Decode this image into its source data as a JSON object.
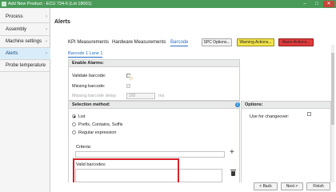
{
  "window": {
    "title": "Add New Product - ECU 734-6 (Lot 18001)",
    "minimize": "–",
    "maximize": "□",
    "close": "✕"
  },
  "sidebar": {
    "items": [
      {
        "label": "Process",
        "chevron": "›"
      },
      {
        "label": "Assembly",
        "chevron": "›"
      },
      {
        "label": "Machine settings",
        "chevron": "›"
      },
      {
        "label": "Alerts",
        "chevron": "›"
      },
      {
        "label": "Probe temperature",
        "chevron": ""
      }
    ]
  },
  "main": {
    "heading": "Alerts",
    "tabs": [
      {
        "label": "KPI Measurements"
      },
      {
        "label": "Hardware Measurements"
      },
      {
        "label": "Barcode"
      }
    ],
    "spc_button": "SPC Options...",
    "warning_button": "Warning Actions...",
    "alarm_button": "Alarm Actions...",
    "subtab": "Barcode 1 Lane 1",
    "enable_alarms": {
      "header": "Enable Alarms:",
      "validate_barcode": "Validate barcode:",
      "missing_barcode": "Missing barcode:",
      "missing_delay": "Missing barcode delay:",
      "missing_delay_value": "100",
      "missing_delay_unit": "ms"
    },
    "selection": {
      "header": "Selection method:",
      "options": [
        "List",
        "Prefix, Contains, Suffix",
        "Regular expression"
      ],
      "selected": "List",
      "criteria_label": "Criteria:",
      "valid_barcodes_label": "Valid barcodes:"
    },
    "options": {
      "header": "Options:",
      "use_for_changeover": "Use for changeover:"
    },
    "info_glyph": "i",
    "add_glyph": "+"
  },
  "footer": {
    "back": "< Back",
    "next": "Next >",
    "finish": "Finish"
  }
}
